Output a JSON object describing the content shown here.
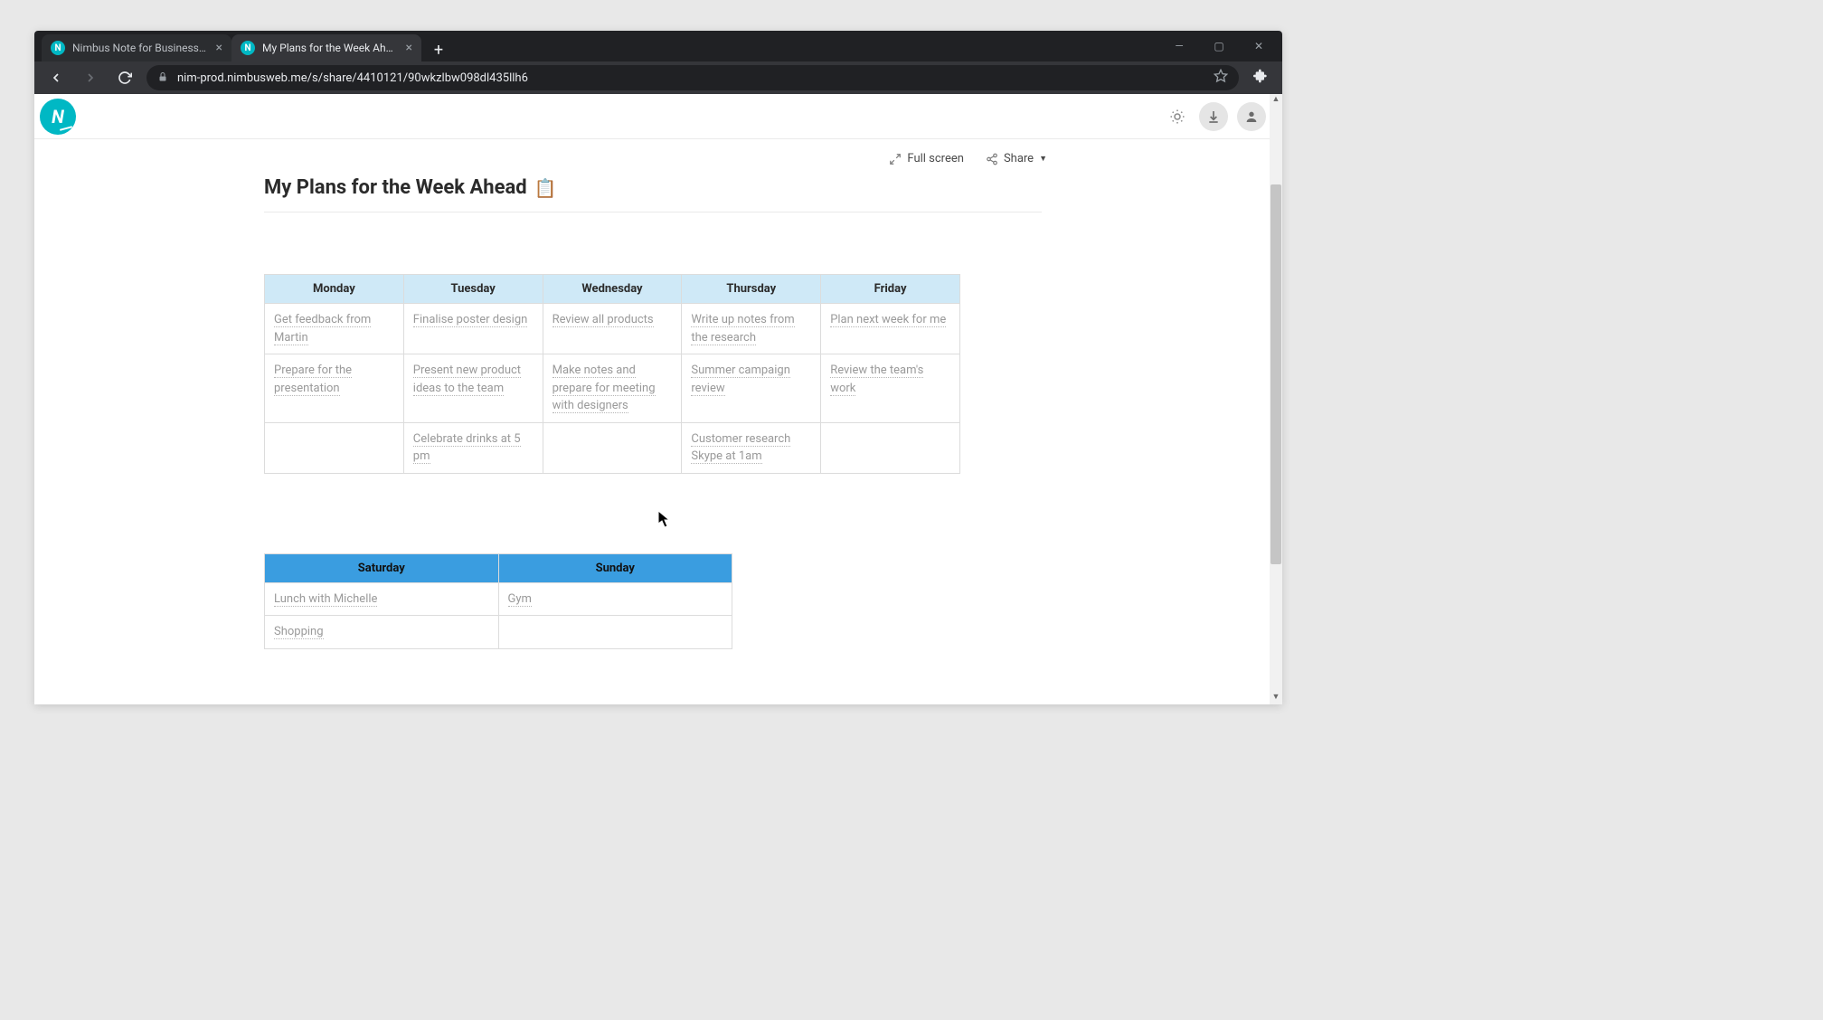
{
  "browser": {
    "tabs": [
      {
        "title": "Nimbus Note for Business - Org…",
        "active": false
      },
      {
        "title": "My Plans for the Week Ahead 📋",
        "active": true
      }
    ],
    "url": "nim-prod.nimbusweb.me/s/share/4410121/90wkzlbw098dl435llh6"
  },
  "actions": {
    "fullscreen": "Full screen",
    "share": "Share"
  },
  "doc": {
    "title": "My Plans for the Week Ahead",
    "title_emoji": "📋"
  },
  "weekday_table": {
    "headers": [
      "Monday",
      "Tuesday",
      "Wednesday",
      "Thursday",
      "Friday"
    ],
    "rows": [
      [
        "Get feedback from Martin",
        "Finalise poster design",
        "Review all products",
        "Write up notes from the research",
        "Plan next week for me"
      ],
      [
        "Prepare for the presentation",
        "Present new product ideas to the team",
        "Make notes and prepare for meeting with designers",
        "Summer campaign review",
        "Review the team's work"
      ],
      [
        "",
        "Celebrate drinks at 5 pm",
        "",
        "Customer research Skype at 1am",
        ""
      ]
    ]
  },
  "weekend_table": {
    "headers": [
      "Saturday",
      "Sunday"
    ],
    "rows": [
      [
        "Lunch with Michelle",
        "Gym"
      ],
      [
        "Shopping",
        ""
      ]
    ]
  }
}
